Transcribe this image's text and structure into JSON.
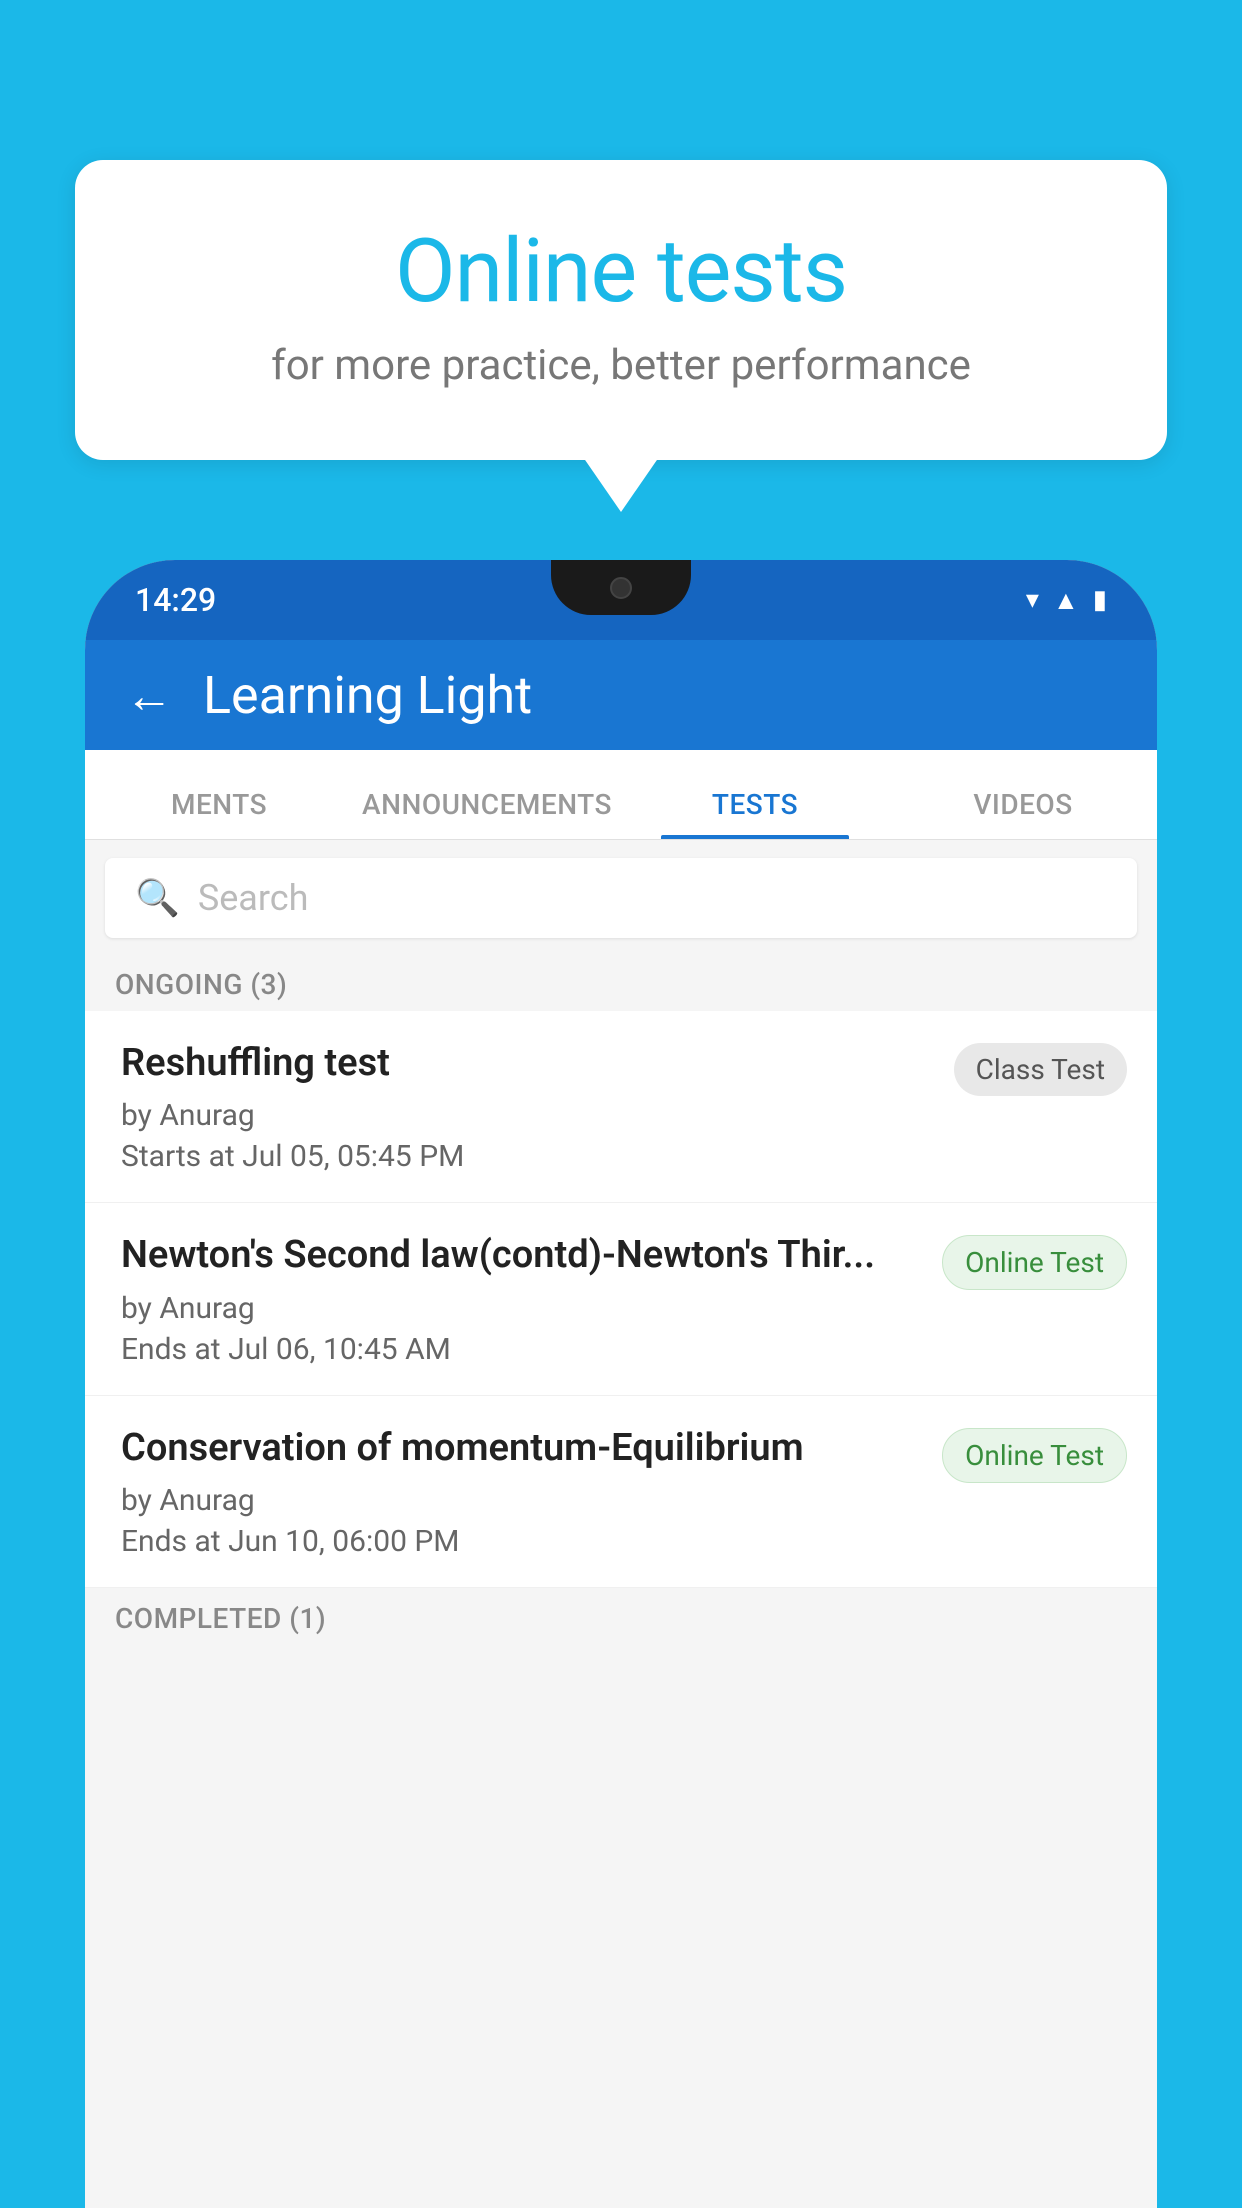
{
  "background_color": "#1BB8E8",
  "speech_bubble": {
    "title": "Online tests",
    "subtitle": "for more practice, better performance"
  },
  "phone": {
    "status_bar": {
      "time": "14:29",
      "icons": [
        "wifi",
        "signal",
        "battery"
      ]
    },
    "header": {
      "title": "Learning Light",
      "back_label": "←"
    },
    "tabs": [
      {
        "label": "MENTS",
        "active": false
      },
      {
        "label": "ANNOUNCEMENTS",
        "active": false
      },
      {
        "label": "TESTS",
        "active": true
      },
      {
        "label": "VIDEOS",
        "active": false
      }
    ],
    "search": {
      "placeholder": "Search"
    },
    "ongoing_section": {
      "label": "ONGOING (3)"
    },
    "test_items": [
      {
        "name": "Reshuffling test",
        "author": "by Anurag",
        "time_label": "Starts at",
        "time": "Jul 05, 05:45 PM",
        "badge": "Class Test",
        "badge_type": "class"
      },
      {
        "name": "Newton's Second law(contd)-Newton's Thir...",
        "author": "by Anurag",
        "time_label": "Ends at",
        "time": "Jul 06, 10:45 AM",
        "badge": "Online Test",
        "badge_type": "online"
      },
      {
        "name": "Conservation of momentum-Equilibrium",
        "author": "by Anurag",
        "time_label": "Ends at",
        "time": "Jun 10, 06:00 PM",
        "badge": "Online Test",
        "badge_type": "online"
      }
    ],
    "completed_section": {
      "label": "COMPLETED (1)"
    }
  }
}
